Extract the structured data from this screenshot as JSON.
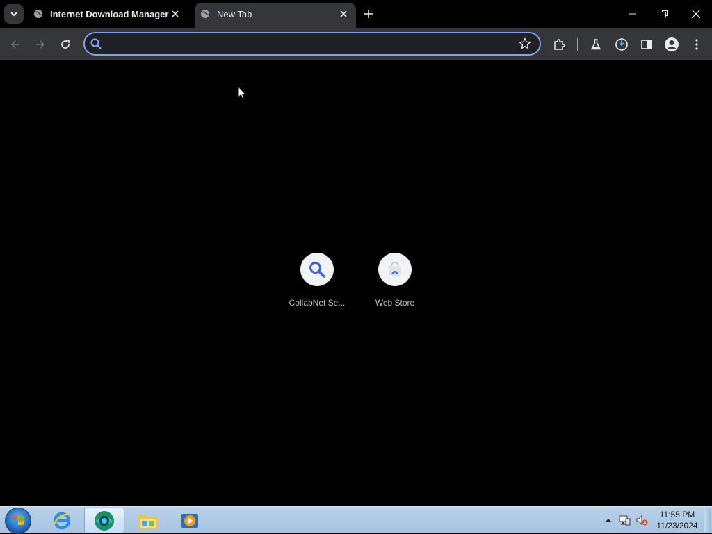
{
  "tabs": [
    {
      "title": "Internet Download Manager is",
      "active": false
    },
    {
      "title": "New Tab",
      "active": true
    }
  ],
  "omnibox": {
    "value": "",
    "placeholder": ""
  },
  "shortcuts": [
    {
      "label": "CollabNet Se...",
      "icon": "search-icon"
    },
    {
      "label": "Web Store",
      "icon": "web-store-icon"
    }
  ],
  "taskbar": {
    "apps": [
      "internet-explorer-icon",
      "browser-icon",
      "file-explorer-icon",
      "media-player-icon"
    ]
  },
  "clock": {
    "time": "11:55 PM",
    "date": "11/23/2024"
  },
  "colors": {
    "accent": "#7ca4f5",
    "toolbar": "#35363a",
    "background": "#000000"
  }
}
